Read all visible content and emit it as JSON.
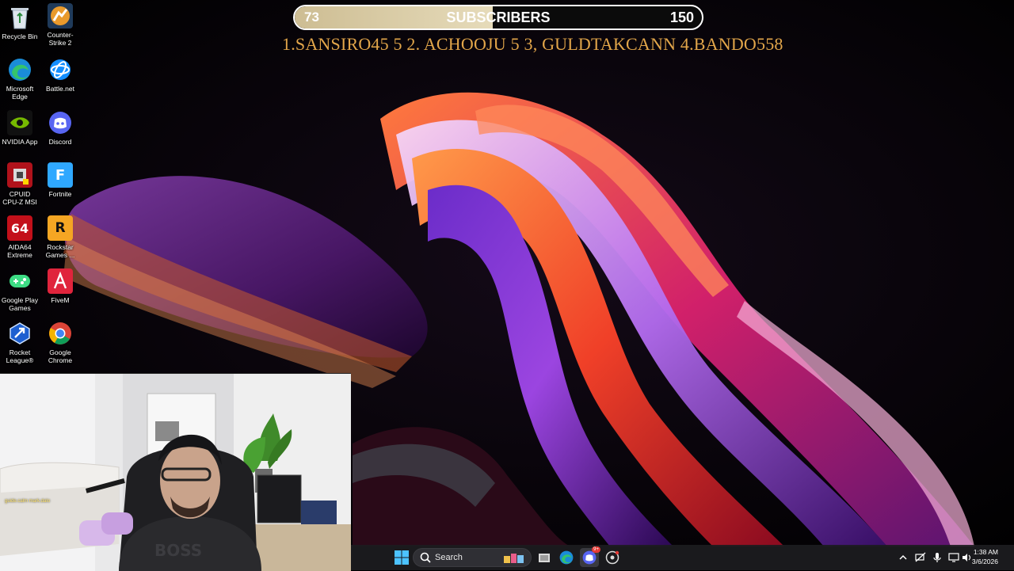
{
  "desktop_icons": [
    {
      "label": "Recycle Bin",
      "icon": "recycle-bin-icon"
    },
    {
      "label": "Counter-Strike 2",
      "icon": "counter-strike-icon"
    },
    {
      "label": "Microsoft Edge",
      "icon": "edge-icon"
    },
    {
      "label": "Battle.net",
      "icon": "battlenet-icon"
    },
    {
      "label": "NVIDIA App",
      "icon": "nvidia-icon"
    },
    {
      "label": "Discord",
      "icon": "discord-icon"
    },
    {
      "label": "CPUID CPU-Z MSI",
      "icon": "cpuz-icon"
    },
    {
      "label": "Fortnite",
      "icon": "fortnite-icon"
    },
    {
      "label": "AIDA64 Extreme",
      "icon": "aida64-icon"
    },
    {
      "label": "Rockstar Games ...",
      "icon": "rockstar-icon"
    },
    {
      "label": "Google Play Games",
      "icon": "google-play-games-icon"
    },
    {
      "label": "FiveM",
      "icon": "fivem-icon"
    },
    {
      "label": "Rocket League®",
      "icon": "rocket-league-icon"
    },
    {
      "label": "Google Chrome",
      "icon": "chrome-icon"
    }
  ],
  "subscriber_goal": {
    "current": "73",
    "label": "SUBSCRIBERS",
    "goal": "150",
    "progress_fraction": 0.486
  },
  "leaderboard_text": "1.SANSIRO45 5 2. ACHOOJU 5  3, GULDTAKCANN  4.BANDO558",
  "webcam": {
    "overlay_text": "guide.calm mark.dalo"
  },
  "taskbar": {
    "search_placeholder": "Search",
    "time": "1:38 AM",
    "date": "3/6/2026",
    "discord_badge": "9+"
  },
  "colors": {
    "leaderboard": "#e2a64a",
    "progress_fill": "#d9cca7",
    "taskbar": "#1c1c20"
  }
}
